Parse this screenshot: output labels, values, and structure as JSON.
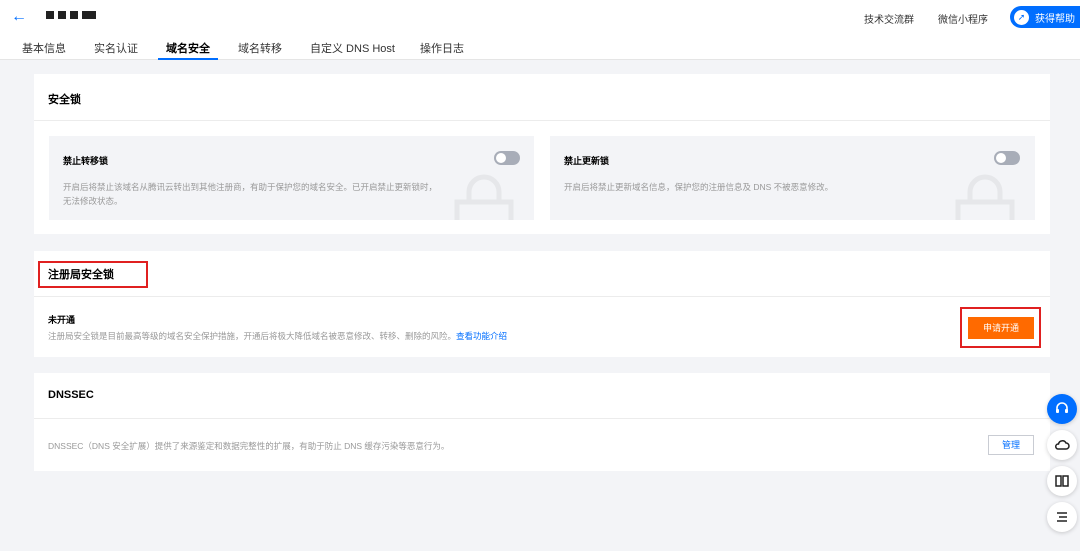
{
  "header": {
    "top_links": [
      "技术交流群",
      "微信小程序"
    ],
    "help_label": "获得帮助"
  },
  "tabs": [
    "基本信息",
    "实名认证",
    "域名安全",
    "域名转移",
    "自定义 DNS Host",
    "操作日志"
  ],
  "active_tab": "域名安全",
  "security_lock": {
    "title": "安全锁",
    "transfer_lock": {
      "title": "禁止转移锁",
      "desc": "开启后将禁止该域名从腾讯云转出到其他注册商，有助于保护您的域名安全。已开启禁止更新锁时，无法修改状态。"
    },
    "update_lock": {
      "title": "禁止更新锁",
      "desc": "开启后将禁止更新域名信息，保护您的注册信息及 DNS 不被恶意修改。"
    }
  },
  "registry_lock": {
    "title": "注册局安全锁",
    "status": "未开通",
    "desc": "注册局安全锁是目前最高等级的域名安全保护措施，开通后将极大降低域名被恶意修改、转移、删除的风险。",
    "link": "查看功能介绍",
    "apply_label": "申请开通"
  },
  "dnssec": {
    "title": "DNSSEC",
    "desc": "DNSSEC（DNS 安全扩展）提供了来源鉴定和数据完整性的扩展，有助于防止 DNS 缓存污染等恶意行为。",
    "manage_label": "管理"
  },
  "colors": {
    "accent": "#006eff",
    "apply_button": "#ff6a00",
    "highlight_box": "#e02020"
  }
}
